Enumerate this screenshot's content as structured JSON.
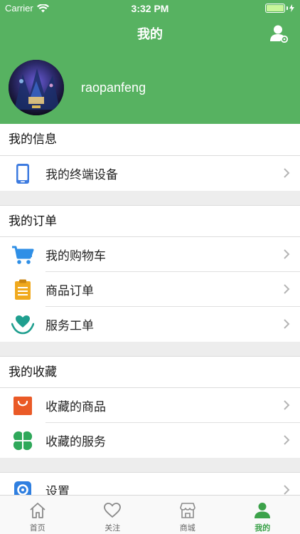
{
  "status_bar": {
    "carrier": "Carrier",
    "time": "3:32 PM"
  },
  "nav": {
    "title": "我的"
  },
  "profile": {
    "username": "raopanfeng"
  },
  "sections": {
    "info": {
      "title": "我的信息",
      "items": [
        {
          "label": "我的终端设备",
          "icon": "phone-icon"
        }
      ]
    },
    "orders": {
      "title": "我的订单",
      "items": [
        {
          "label": "我的购物车",
          "icon": "cart-icon"
        },
        {
          "label": "商品订单",
          "icon": "clipboard-icon"
        },
        {
          "label": "服务工单",
          "icon": "heart-hands-icon"
        }
      ]
    },
    "favorites": {
      "title": "我的收藏",
      "items": [
        {
          "label": "收藏的商品",
          "icon": "shopping-bag-icon"
        },
        {
          "label": "收藏的服务",
          "icon": "clover-icon"
        }
      ]
    },
    "settings": {
      "label": "设置",
      "icon": "gear-icon"
    }
  },
  "tabbar": {
    "tabs": [
      {
        "label": "首页",
        "icon": "home-icon"
      },
      {
        "label": "关注",
        "icon": "heart-icon"
      },
      {
        "label": "商城",
        "icon": "store-icon"
      },
      {
        "label": "我的",
        "icon": "person-icon",
        "active": true
      }
    ]
  },
  "colors": {
    "brand": "#57b261",
    "active_tab": "#3ca24a",
    "background": "#ededed"
  }
}
